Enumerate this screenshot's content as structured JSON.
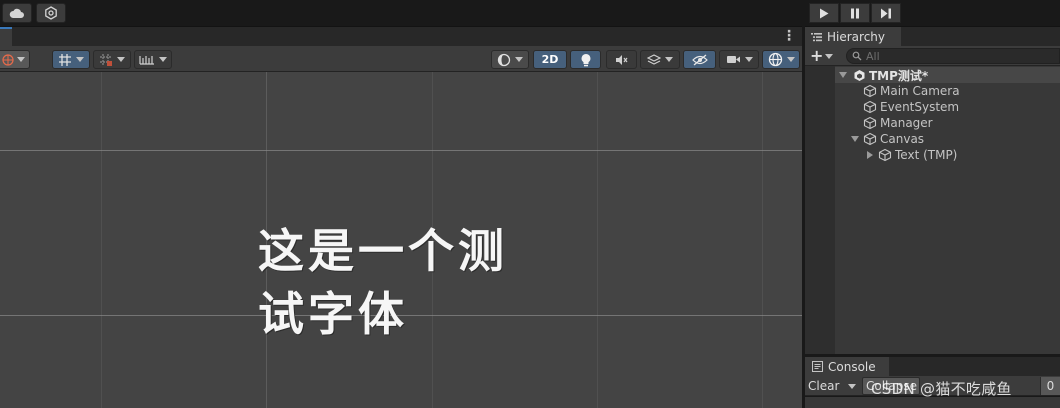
{
  "topbar": {
    "cloud_icon": "cloud-icon",
    "collab_icon": "hexagon-gear-icon",
    "play_icon": "play-icon",
    "pause_icon": "pause-icon",
    "step_icon": "step-icon"
  },
  "scene": {
    "toolbar": {
      "global_icon": "globe-icon",
      "move_snap_icon": "grid-snap-icon",
      "increment_snap_icon": "grid-increment-icon",
      "ruler_icon": "ruler-icon",
      "draw_mode_icon": "shading-sphere-icon",
      "mode_2d_label": "2D",
      "lighting_icon": "lightbulb-icon",
      "audio_icon": "audio-mute-icon",
      "effects_icon": "layers-icon",
      "hidden_icon": "eye-slash-icon",
      "camera_icon": "camera-icon",
      "gizmos_icon": "gizmo-globe-icon"
    },
    "more_menu_label": "⋮",
    "text_line1": "这是一个测",
    "text_line2": "试字体"
  },
  "hierarchy": {
    "tab_label": "Hierarchy",
    "tab_icon": "list-icon",
    "add_label": "+",
    "search_placeholder": "All",
    "scene_name": "TMP测试*",
    "items": [
      {
        "label": "Main Camera"
      },
      {
        "label": "EventSystem"
      },
      {
        "label": "Manager"
      },
      {
        "label": "Canvas"
      },
      {
        "label": "Text (TMP)"
      }
    ]
  },
  "console": {
    "tab_label": "Console",
    "tab_icon": "console-icon",
    "clear_label": "Clear",
    "collapse_label": "Collapse",
    "count_label": "0"
  },
  "watermark": "CSDN @猫不吃咸鱼",
  "colors": {
    "accent_blue": "#46607c",
    "panel_bg": "#383838",
    "scene_bg": "#444444",
    "toolbar_bg": "#3c3c3c"
  }
}
